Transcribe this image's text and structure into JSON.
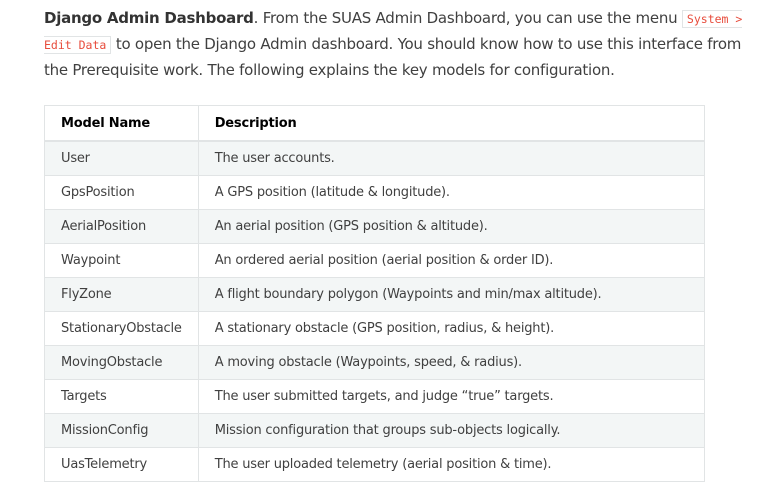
{
  "intro": {
    "heading": "Django Admin Dashboard",
    "text_1": ". From the SUAS Admin Dashboard, you can use the menu ",
    "code": "System > Edit Data",
    "text_2": " to open the Django Admin dashboard. You should know how to use this interface from the Prerequisite work. The following explains the key models for configuration."
  },
  "table": {
    "headers": [
      "Model Name",
      "Description"
    ],
    "rows": [
      {
        "name": "User",
        "description": "The user accounts."
      },
      {
        "name": "GpsPosition",
        "description": "A GPS position (latitude & longitude)."
      },
      {
        "name": "AerialPosition",
        "description": "An aerial position (GPS position & altitude)."
      },
      {
        "name": "Waypoint",
        "description": "An ordered aerial position (aerial position & order ID)."
      },
      {
        "name": "FlyZone",
        "description": "A flight boundary polygon (Waypoints and min/max altitude)."
      },
      {
        "name": "StationaryObstacle",
        "description": "A stationary obstacle (GPS position, radius, & height)."
      },
      {
        "name": "MovingObstacle",
        "description": "A moving obstacle (Waypoints, speed, & radius)."
      },
      {
        "name": "Targets",
        "description": "The user submitted targets, and judge “true” targets."
      },
      {
        "name": "MissionConfig",
        "description": "Mission configuration that groups sub-objects logically."
      },
      {
        "name": "UasTelemetry",
        "description": "The user uploaded telemetry (aerial position & time)."
      }
    ]
  }
}
